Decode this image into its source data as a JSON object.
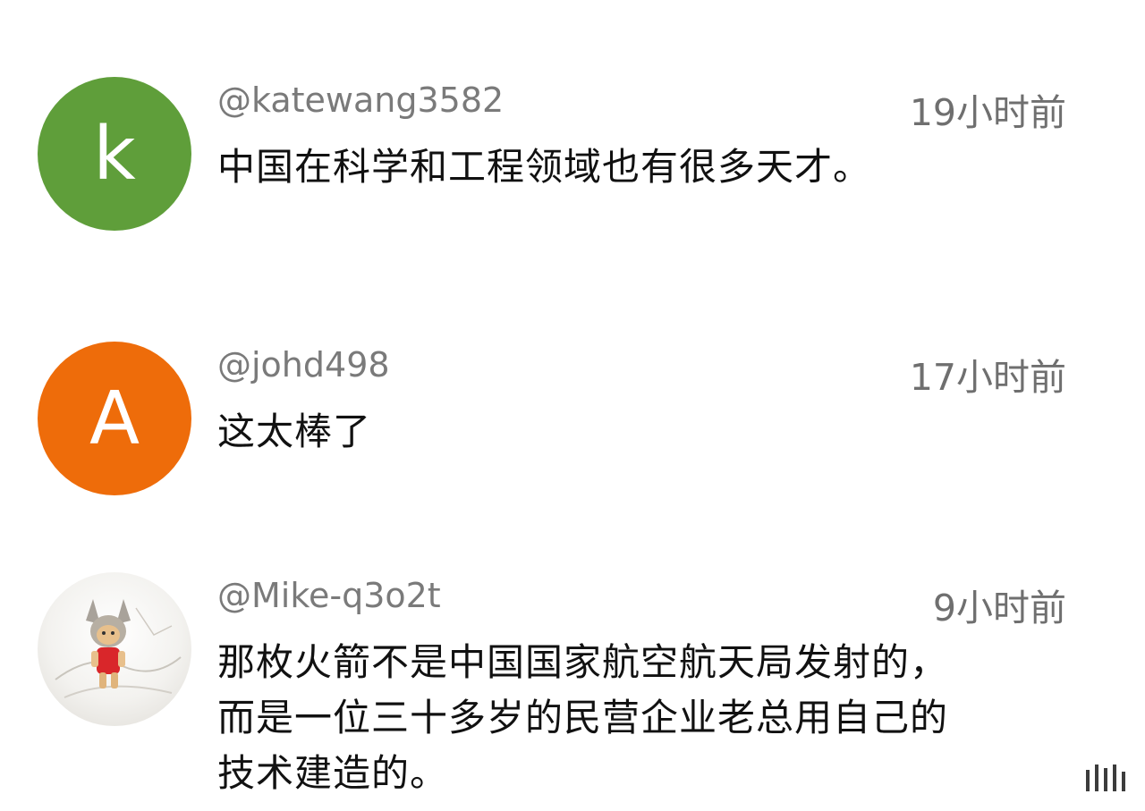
{
  "comments": [
    {
      "avatar_letter": "k",
      "avatar_color": "#5f9e3a",
      "username": "@katewang3582",
      "time": "19小时前",
      "text": "中国在科学和工程领域也有很多天才。"
    },
    {
      "avatar_letter": "A",
      "avatar_color": "#ee6c0a",
      "username": "@johd498",
      "time": "17小时前",
      "text": "这太棒了"
    },
    {
      "avatar_image": "cartoon-character-photo",
      "username": "@Mike-q3o2t",
      "time": "9小时前",
      "text_lines": [
        "那枚火箭不是中国国家航空航天局发射的，",
        "而是一位三十多岁的民营企业老总用自己的",
        "技术建造的。"
      ]
    }
  ]
}
